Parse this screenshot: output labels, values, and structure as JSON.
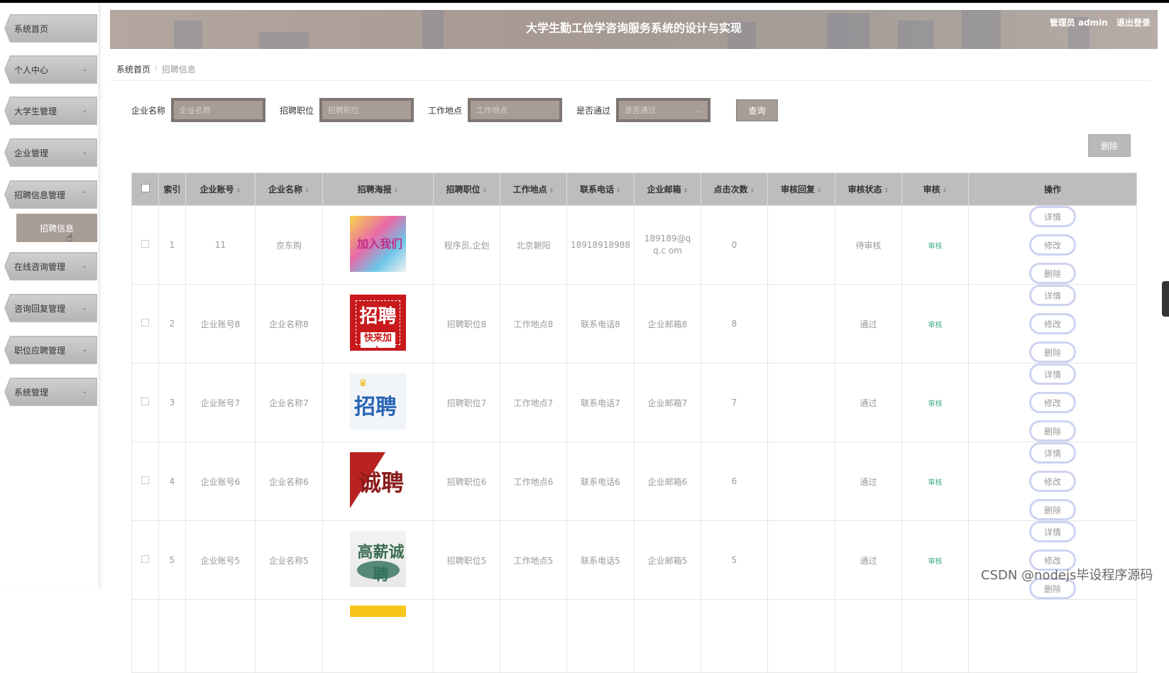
{
  "header": {
    "title": "大学生勤工俭学咨询服务系统的设计与实现",
    "user_label": "管理员 admin",
    "logout": "退出登录"
  },
  "sidebar": {
    "items": [
      {
        "label": "系统首页",
        "chevron": ""
      },
      {
        "label": "个人中心",
        "chevron": "⌄"
      },
      {
        "label": "大学生管理",
        "chevron": "⌄"
      },
      {
        "label": "企业管理",
        "chevron": "⌄"
      },
      {
        "label": "招聘信息管理",
        "chevron": "⌃"
      },
      {
        "label": "在线咨询管理",
        "chevron": "⌄"
      },
      {
        "label": "咨询回复管理",
        "chevron": "⌄"
      },
      {
        "label": "职位应聘管理",
        "chevron": "⌄"
      },
      {
        "label": "系统管理",
        "chevron": "⌄"
      }
    ],
    "submenu_active": "招聘信息"
  },
  "breadcrumb": {
    "home": "系统首页",
    "sep": "⁝",
    "current": "招聘信息"
  },
  "search": {
    "company_label": "企业名称",
    "company_placeholder": "企业名称",
    "position_label": "招聘职位",
    "position_placeholder": "招聘职位",
    "location_label": "工作地点",
    "location_placeholder": "工作地点",
    "passed_label": "是否通过",
    "passed_placeholder": "是否通过",
    "query": "查询"
  },
  "toolbar": {
    "delete": "删除"
  },
  "table": {
    "headers": [
      "索引",
      "企业账号",
      "企业名称",
      "招聘海报",
      "招聘职位",
      "工作地点",
      "联系电话",
      "企业邮箱",
      "点击次数",
      "审核回复",
      "审核状态",
      "审核",
      "操作"
    ],
    "rows": [
      {
        "index": "1",
        "account": "11",
        "company": "京东购",
        "position": "程序员,企划",
        "location": "北京朝阳",
        "phone": "18918918988",
        "email": "189189@qq.c om",
        "clicks": "0",
        "reply": "",
        "status": "待审核",
        "audit": "审核"
      },
      {
        "index": "2",
        "account": "企业账号8",
        "company": "企业名称8",
        "position": "招聘职位8",
        "location": "工作地点8",
        "phone": "联系电话8",
        "email": "企业邮箱8",
        "clicks": "8",
        "reply": "",
        "status": "通过",
        "audit": "审核"
      },
      {
        "index": "3",
        "account": "企业账号7",
        "company": "企业名称7",
        "position": "招聘职位7",
        "location": "工作地点7",
        "phone": "联系电话7",
        "email": "企业邮箱7",
        "clicks": "7",
        "reply": "",
        "status": "通过",
        "audit": "审核"
      },
      {
        "index": "4",
        "account": "企业账号6",
        "company": "企业名称6",
        "position": "招聘职位6",
        "location": "工作地点6",
        "phone": "联系电话6",
        "email": "企业邮箱6",
        "clicks": "6",
        "reply": "",
        "status": "通过",
        "audit": "审核"
      },
      {
        "index": "5",
        "account": "企业账号5",
        "company": "企业名称5",
        "position": "招聘职位5",
        "location": "工作地点5",
        "phone": "联系电话5",
        "email": "企业邮箱5",
        "clicks": "5",
        "reply": "",
        "status": "通过",
        "audit": "审核"
      }
    ],
    "ops": {
      "detail": "详情",
      "edit": "修改",
      "delete": "删除"
    },
    "posters": {
      "p1": "加入我们",
      "p2_main": "招聘",
      "p2_sub": "快来加入",
      "p3": "招聘",
      "p4": "诚聘",
      "p5": "高薪诚聘"
    }
  },
  "watermark": "CSDN @nodejs毕设程序源码"
}
